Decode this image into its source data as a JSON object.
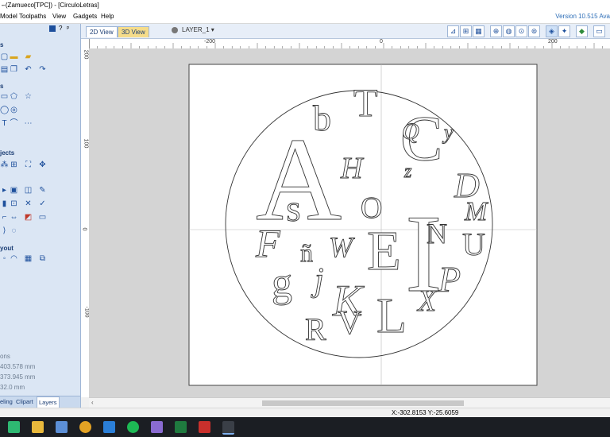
{
  "window": {
    "title": "- (Zamueco[TPC]) - [CirculoLetras]",
    "minimize_glyph": "–"
  },
  "menu": [
    "Model",
    "Toolpaths",
    "View",
    "Gadgets",
    "Help"
  ],
  "version": "Version 10.515 Ava",
  "panel": {
    "section_titles": [
      "s",
      "s",
      "jects",
      "yout"
    ],
    "stats": [
      "ons",
      "403.578 mm",
      "373.945 mm",
      "32.0 mm"
    ],
    "tabs": [
      "eling",
      "Clipart",
      "Layers"
    ],
    "active_tab": "Layers",
    "pin_glyphs": [
      "?",
      "ᵖ"
    ]
  },
  "view": {
    "tab_2d": "2D View",
    "tab_3d": "3D View",
    "layer": "LAYER_1 ▾"
  },
  "ruler": {
    "h_labels": [
      "-200",
      "0",
      "200"
    ],
    "v_labels": [
      "200",
      "100",
      "0",
      "-100"
    ]
  },
  "status": {
    "coords": "X:-302.8153 Y:-25.6059"
  },
  "canvas": {
    "letters": [
      "A",
      "b",
      "T",
      "C",
      "Q",
      "y",
      "z",
      "D",
      "H",
      "S",
      "O",
      "I",
      "M",
      "F",
      "ñ",
      "W",
      "E",
      "N",
      "U",
      "g",
      "j",
      "K",
      "P",
      "X",
      "R",
      "V",
      "L"
    ]
  },
  "colors": {
    "panel_bg": "#dbe6f4",
    "accent": "#2f6fb8",
    "tab_3d": "#f5dc8a",
    "canvas_bg": "#d4d4d4"
  },
  "icons": {
    "panel": [
      "new-file-icon",
      "open-file-icon",
      "save-icon",
      "import-icon",
      "copy-icon",
      "undo-icon",
      "redo-icon",
      "rectangle-icon",
      "polygon-icon",
      "star-icon",
      "circle-icon",
      "spiral-icon",
      "text-icon",
      "text-on-curve-icon",
      "node-edit-icon",
      "group-icon",
      "ungroup-icon",
      "transform-icon",
      "align-icon",
      "weld-icon",
      "trim-icon",
      "mirror-icon",
      "offset-icon",
      "fillet-icon",
      "knife-icon",
      "measure-icon",
      "array-icon",
      "layout-icon",
      "nest-icon",
      "sequence-icon"
    ],
    "toolbar": [
      "snap-grid-icon",
      "snap-icon",
      "grid-icon",
      "center-icon",
      "zoom-fit-icon",
      "zoom-in-icon",
      "zoom-box-icon",
      "draw-icon",
      "cursor-icon",
      "shade-icon",
      "render-icon",
      "window-icon"
    ]
  }
}
